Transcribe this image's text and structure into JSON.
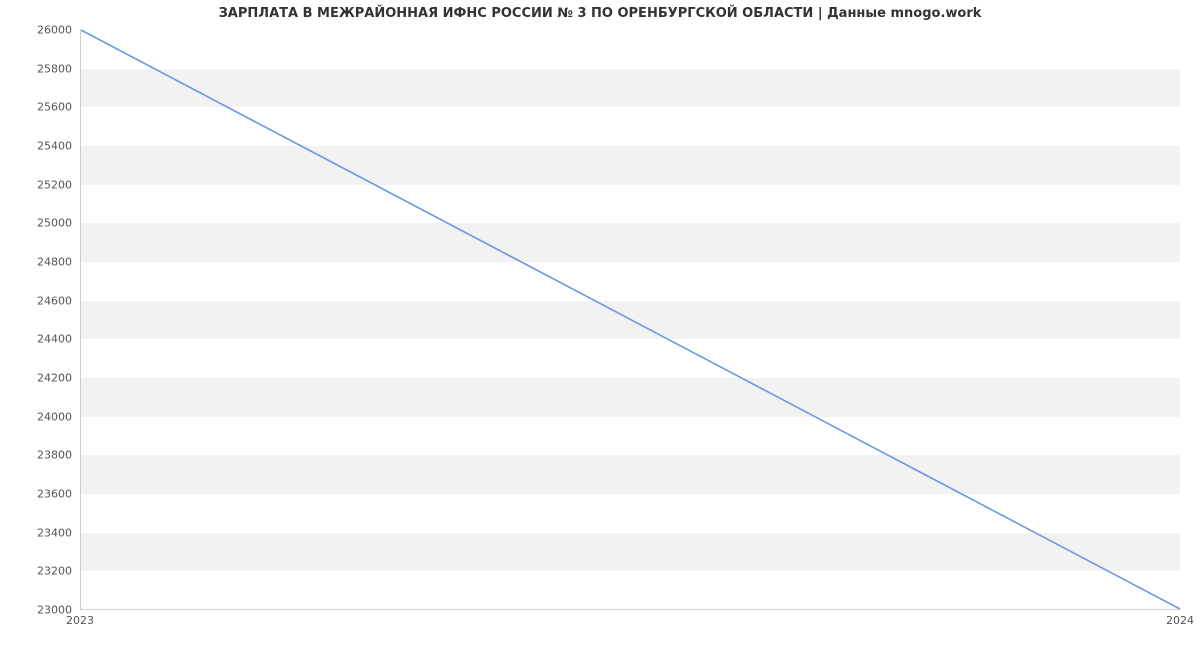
{
  "chart_data": {
    "type": "line",
    "title": "ЗАРПЛАТА В МЕЖРАЙОННАЯ ИФНС РОССИИ № 3 ПО ОРЕНБУРГСКОЙ ОБЛАСТИ | Данные mnogo.work",
    "x": [
      2023,
      2024
    ],
    "values": [
      26000,
      23000
    ],
    "xlabel": "",
    "ylabel": "",
    "y_ticks": [
      23000,
      23200,
      23400,
      23600,
      23800,
      24000,
      24200,
      24400,
      24600,
      24800,
      25000,
      25200,
      25400,
      25600,
      25800,
      26000
    ],
    "x_ticks": [
      2023,
      2024
    ],
    "ylim": [
      23000,
      26000
    ],
    "xlim": [
      2023,
      2024
    ],
    "line_color": "#6699e0"
  }
}
